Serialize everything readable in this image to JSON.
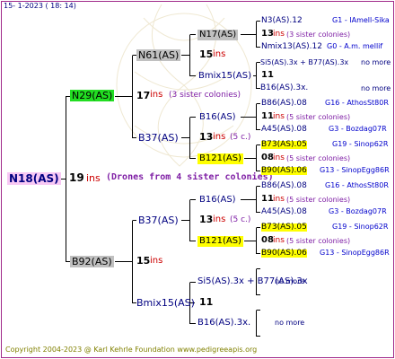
{
  "date_line": "15-   1-2023 (  18:  14)",
  "copyright": "Copyright 2004-2023 @ Karl Kehrle Foundation   www.pedigreeapis.org",
  "watermark": "PedigreeApis",
  "colors": {
    "frame": "#a02a8a",
    "lines": "#000000",
    "green": "#22dd22",
    "gray": "#c0c0c0",
    "yellow": "#ffff00",
    "pink": "#f8c8f4",
    "red": "#cc0000",
    "navy": "#000080",
    "blue": "#0000cc",
    "purple": "#7f1fa5",
    "olive": "#808000"
  },
  "root": {
    "label": "N18(AS)",
    "gen": "19",
    "ins": "ins",
    "note": "(Drones from 4 sister colonies)"
  },
  "l1": {
    "top": {
      "label": "N29(AS)",
      "gen": "17",
      "ins": "ins",
      "note": "(3 sister colonies)"
    },
    "bottom": {
      "label": "B92(AS)",
      "gen": "15",
      "ins": "ins"
    }
  },
  "l2": {
    "a": {
      "label": "N61(AS)",
      "gen": "15",
      "ins": "ins"
    },
    "b": {
      "label": "B37(AS)",
      "gen": "13",
      "ins": "ins",
      "note": "(5 c.)"
    },
    "c": {
      "label": "B37(AS)",
      "gen": "13",
      "ins": "ins",
      "note": "(5 c.)"
    },
    "d": {
      "label": "Bmix15(AS)",
      "gen": "11"
    }
  },
  "l3": {
    "a1": {
      "label": "N17(AS)",
      "gen": "13",
      "ins": "ins",
      "note": "(3 sister colonies)"
    },
    "a2": {
      "label": "Bmix15(AS)",
      "gen": "11"
    },
    "b1": {
      "label": "B16(AS)",
      "gen": "11",
      "ins": "ins",
      "note": "(5 sister colonies)"
    },
    "b2": {
      "label": "B121(AS)",
      "gen": "08",
      "ins": "ins",
      "note": "(5 sister colonies)"
    },
    "c1": {
      "label": "B16(AS)",
      "gen": "11",
      "ins": "ins",
      "note": "(5 sister colonies)"
    },
    "c2": {
      "label": "B121(AS)",
      "gen": "08",
      "ins": "ins",
      "note": "(5 sister colonies)"
    },
    "d1": {
      "label": "Si5(AS).3x + B77(AS).3x",
      "more": "no more"
    },
    "d2": {
      "label": "B16(AS).3x.",
      "more": "no more"
    }
  },
  "l4": {
    "r1": {
      "label": "N3(AS).12",
      "gid": "G1 - IAmell-Sika"
    },
    "r2": {
      "label": "Nmix13(AS).12",
      "gid": "G0 - A.m. mellif"
    },
    "r3": {
      "label": "Si5(AS).3x + B77(AS).3x",
      "more": "no more"
    },
    "r4": {
      "label": "B16(AS).3x.",
      "more": "no more"
    },
    "r5": {
      "label": "B86(AS).08",
      "gid": "G16 - AthosSt80R"
    },
    "r6": {
      "label": "A45(AS).08",
      "gid": "G3 - Bozdag07R"
    },
    "r7": {
      "label": "B73(AS).05",
      "gid": "G19 - Sinop62R"
    },
    "r8": {
      "label": "B90(AS).06",
      "gid": "G13 - SinopEgg86R"
    },
    "r9": {
      "label": "B86(AS).08",
      "gid": "G16 - AthosSt80R"
    },
    "r10": {
      "label": "A45(AS).08",
      "gid": "G3 - Bozdag07R"
    },
    "r11": {
      "label": "B73(AS).05",
      "gid": "G19 - Sinop62R"
    },
    "r12": {
      "label": "B90(AS).06",
      "gid": "G13 - SinopEgg86R"
    }
  }
}
